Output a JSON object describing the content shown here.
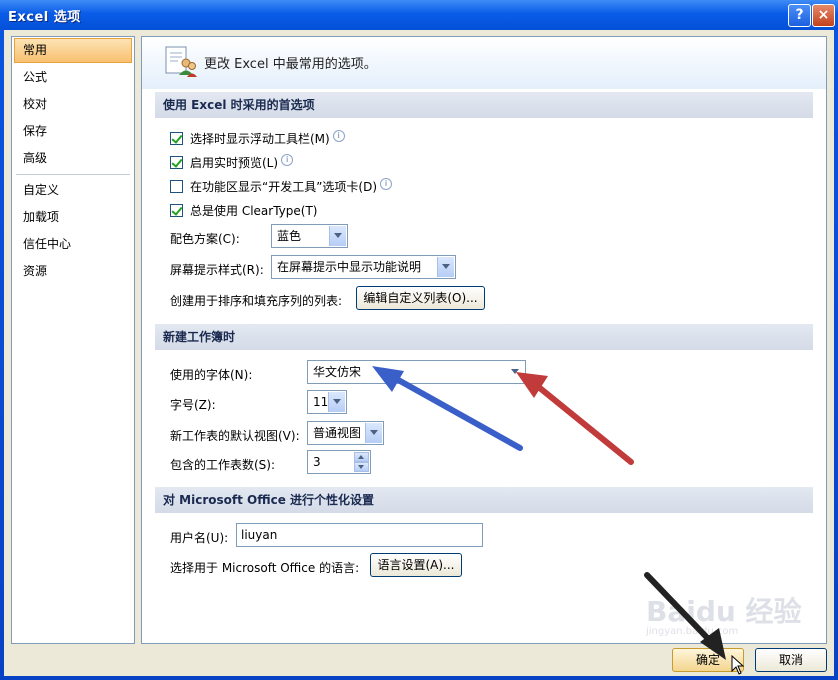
{
  "window": {
    "title": "Excel 选项",
    "help_label": "?",
    "close_label": "×"
  },
  "sidebar": {
    "items": [
      {
        "label": "常用"
      },
      {
        "label": "公式"
      },
      {
        "label": "校对"
      },
      {
        "label": "保存"
      },
      {
        "label": "高级"
      },
      {
        "label": "自定义"
      },
      {
        "label": "加载项"
      },
      {
        "label": "信任中心"
      },
      {
        "label": "资源"
      }
    ]
  },
  "banner": {
    "text": "更改 Excel 中最常用的选项。"
  },
  "section1": {
    "title": "使用 Excel 时采用的首选项",
    "checks": [
      {
        "label": "选择时显示浮动工具栏(M)",
        "checked": true
      },
      {
        "label": "启用实时预览(L)",
        "checked": true
      },
      {
        "label": "在功能区显示“开发工具”选项卡(D)",
        "checked": false
      },
      {
        "label": "总是使用 ClearType(T)",
        "checked": true
      }
    ],
    "color_scheme_label": "配色方案(C):",
    "color_scheme_value": "蓝色",
    "tooltip_style_label": "屏幕提示样式(R):",
    "tooltip_style_value": "在屏幕提示中显示功能说明",
    "custom_list_label": "创建用于排序和填充序列的列表:",
    "custom_list_button": "编辑自定义列表(O)..."
  },
  "section2": {
    "title": "新建工作簿时",
    "font_label": "使用的字体(N):",
    "font_value": "华文仿宋",
    "size_label": "字号(Z):",
    "size_value": "11",
    "view_label": "新工作表的默认视图(V):",
    "view_value": "普通视图",
    "sheets_label": "包含的工作表数(S):",
    "sheets_value": "3"
  },
  "section3": {
    "title": "对 Microsoft Office 进行个性化设置",
    "username_label": "用户名(U):",
    "username_value": "liuyan",
    "language_label": "选择用于 Microsoft Office 的语言:",
    "language_button": "语言设置(A)..."
  },
  "footer": {
    "ok_label": "确定",
    "cancel_label": "取消"
  },
  "watermark": {
    "text": "Baidu 经验",
    "subtext": "jingyan.baidu.com"
  },
  "annotations": {
    "blue": "#3a5fc8",
    "red": "#c23b3b",
    "black": "#222222"
  },
  "icons": {
    "banner": "options-people-icon",
    "cursor": "mouse-pointer-icon",
    "info": "info-icon"
  }
}
